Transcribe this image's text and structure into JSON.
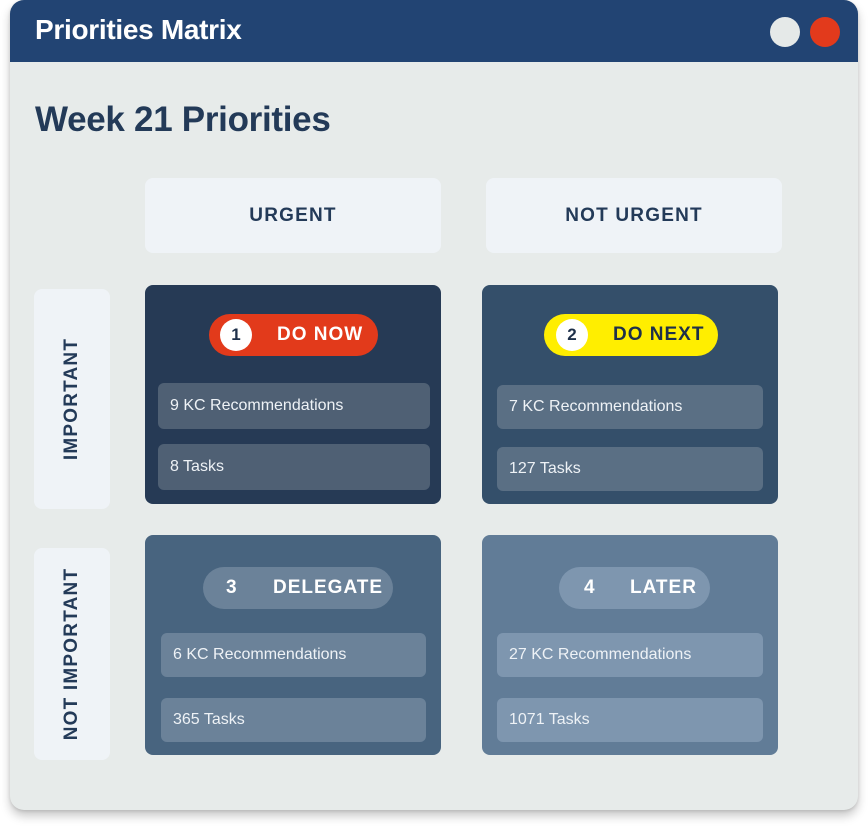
{
  "window": {
    "title": "Priorities Matrix",
    "controls": [
      {
        "name": "minimize",
        "color": "#E5E9E8"
      },
      {
        "name": "close",
        "color": "#E23A1C"
      }
    ]
  },
  "heading": "Week 21 Priorities",
  "columns": [
    "URGENT",
    "NOT URGENT"
  ],
  "rows": [
    "IMPORTANT",
    "NOT IMPORTANT"
  ],
  "quadrants": [
    {
      "number": "1",
      "label": "DO NOW",
      "color": "#E23A1B",
      "stats": [
        "9 KC Recommendations",
        "8 Tasks"
      ]
    },
    {
      "number": "2",
      "label": "DO NEXT",
      "color": "#FFEE00",
      "stats": [
        "7 KC Recommendations",
        "127 Tasks"
      ]
    },
    {
      "number": "3",
      "label": "DELEGATE",
      "color": "#6B8299",
      "stats": [
        "6 KC Recommendations",
        "365 Tasks"
      ]
    },
    {
      "number": "4",
      "label": "LATER",
      "color": "#7E96AF",
      "stats": [
        "27 KC Recommendations",
        "1071 Tasks"
      ]
    }
  ]
}
